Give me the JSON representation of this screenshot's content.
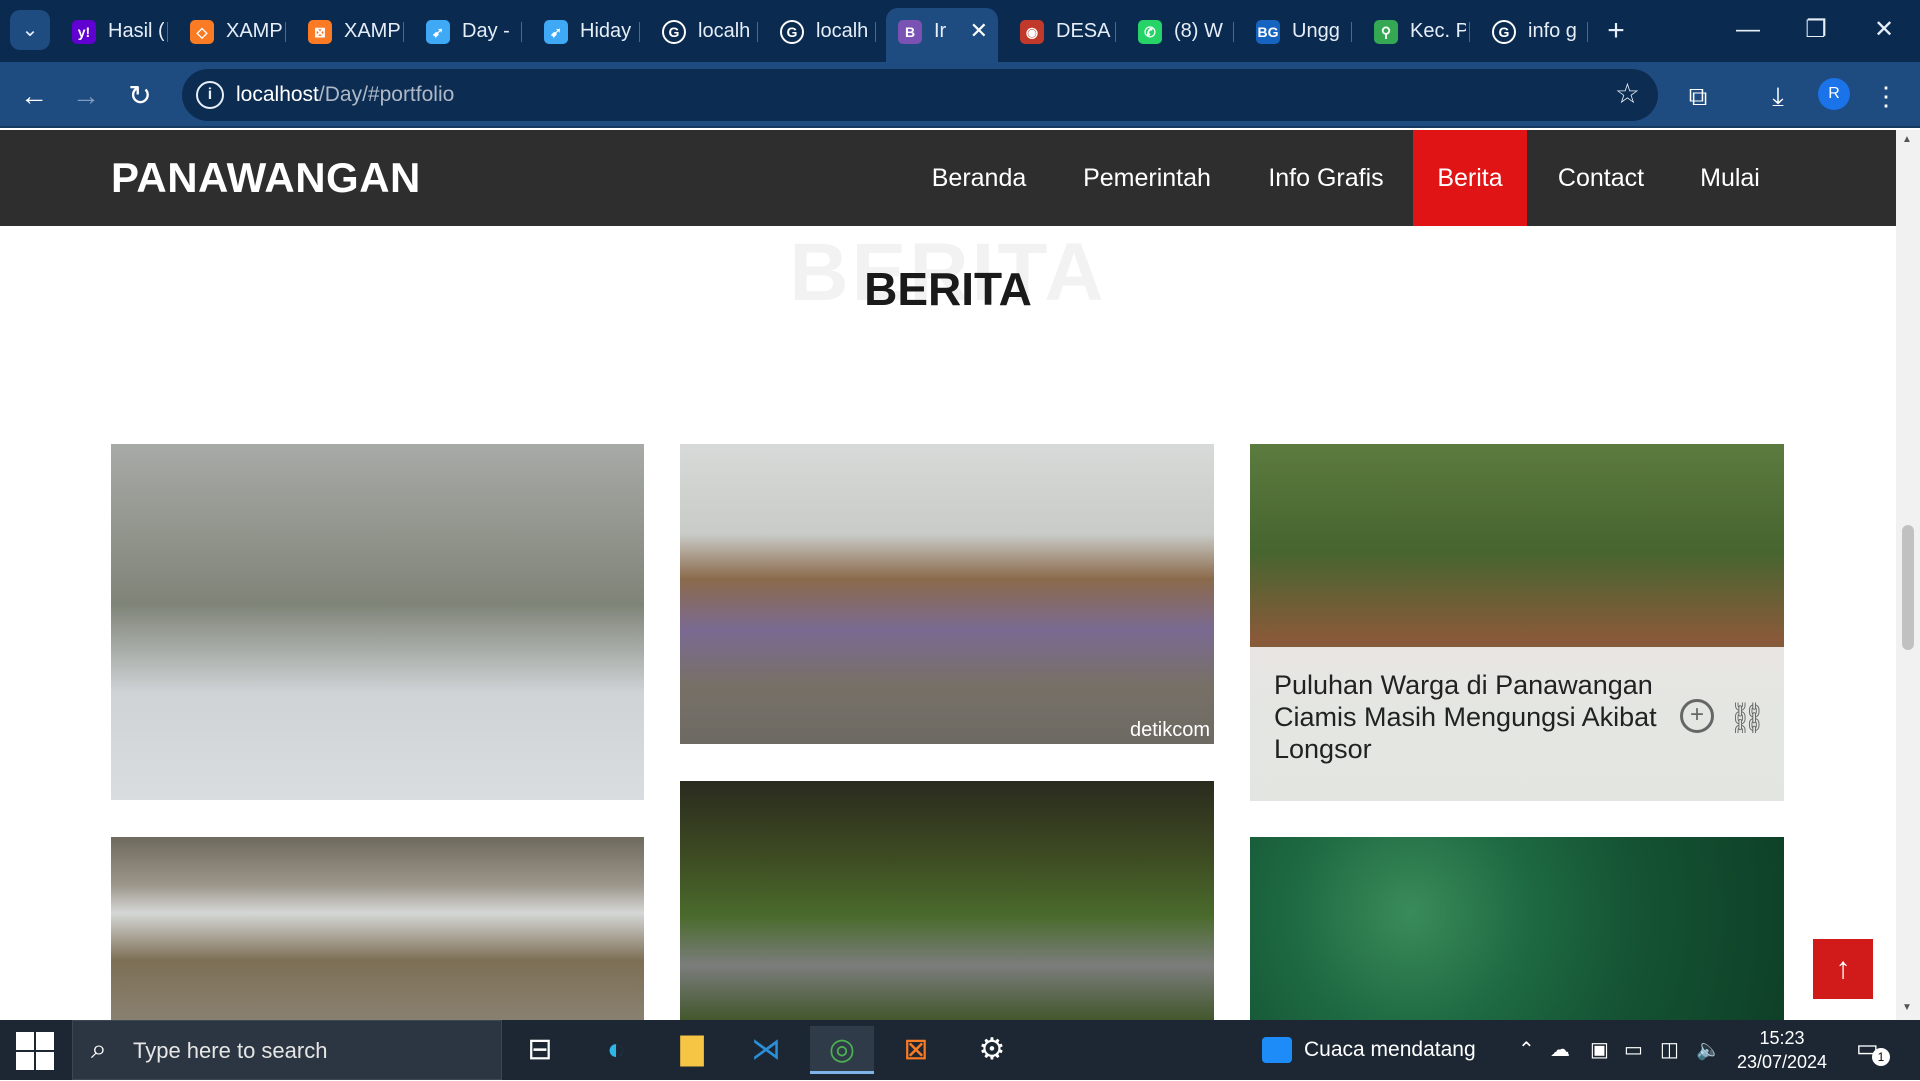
{
  "browser": {
    "tabs": [
      {
        "title": "Hasil (",
        "icon": "yahoo-icon",
        "color": "#6001d2",
        "glyph": "y!"
      },
      {
        "title": "XAMP",
        "icon": "xampp-icon",
        "color": "#fb7a24",
        "glyph": "◇"
      },
      {
        "title": "XAMP",
        "icon": "xampp-icon",
        "color": "#fb7a24",
        "glyph": "⊠"
      },
      {
        "title": "Day -",
        "icon": "bird-icon",
        "color": "#3fa9f5",
        "glyph": "➹"
      },
      {
        "title": "Hiday",
        "icon": "bird-icon",
        "color": "#3fa9f5",
        "glyph": "➹"
      },
      {
        "title": "localh",
        "icon": "google-icon",
        "color": "#ffffff",
        "glyph": "G"
      },
      {
        "title": "localh",
        "icon": "google-icon",
        "color": "#ffffff",
        "glyph": "G"
      },
      {
        "title": "Ir",
        "icon": "bootstrap-icon",
        "color": "#7952b3",
        "glyph": "B"
      },
      {
        "title": "DESA",
        "icon": "seal-icon",
        "color": "#c0392b",
        "glyph": "◉"
      },
      {
        "title": "(8) W",
        "icon": "whatsapp-icon",
        "color": "#25d366",
        "glyph": "✆"
      },
      {
        "title": "Ungg",
        "icon": "bg-icon",
        "color": "#1565c0",
        "glyph": "BG"
      },
      {
        "title": "Kec. P",
        "icon": "maps-pin-icon",
        "color": "#34a853",
        "glyph": "⚲"
      },
      {
        "title": "info g",
        "icon": "google-icon",
        "color": "#ffffff",
        "glyph": "G"
      }
    ],
    "url_host": "localhost",
    "url_path": "/Day/#portfolio",
    "profile_initial": "R"
  },
  "site": {
    "brand": "PANAWANGAN",
    "nav": [
      "Beranda",
      "Pemerintah",
      "Info Grafis",
      "Berita",
      "Contact",
      "Mulai"
    ],
    "active_nav": "Berita",
    "accent": "#e01414",
    "section_bg_title": "BERITA",
    "section_title": "BERITA",
    "cards": [
      {
        "photo": "flag-ceremony-photo"
      },
      {
        "photo": "school-gate-photo",
        "watermark": "detikcom"
      },
      {
        "photo": "landslide-photo",
        "caption": "Puluhan Warga di Panawangan Ciamis Masih Mengungsi Akibat Longsor"
      },
      {
        "photo": "village-road-photo"
      },
      {
        "photo": "forest-road-photo"
      },
      {
        "photo": "aerial-forest-photo"
      }
    ]
  },
  "taskbar": {
    "search_placeholder": "Type here to search",
    "weather": "Cuaca mendatang",
    "time": "15:23",
    "date": "23/07/2024",
    "notifications": "1"
  }
}
